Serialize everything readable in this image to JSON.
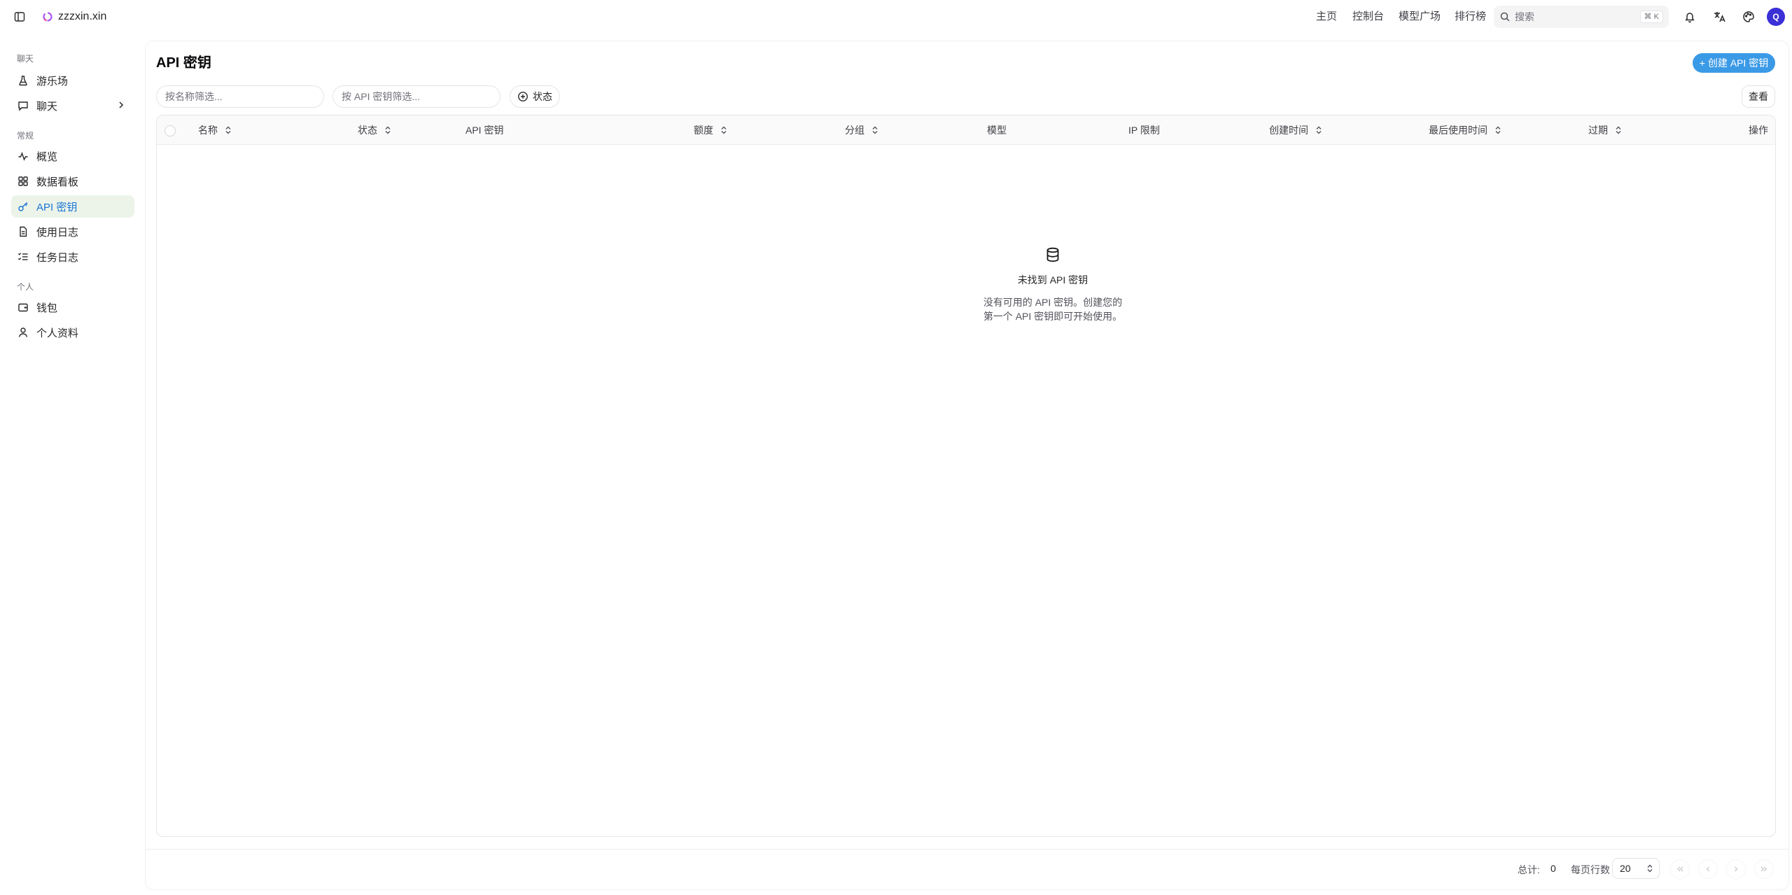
{
  "site": {
    "name": "zzzxin.xin"
  },
  "topnav": {
    "home": "主页",
    "console": "控制台",
    "models": "模型广场",
    "ranking": "排行榜"
  },
  "search": {
    "placeholder": "搜索",
    "shortcut": "⌘ K"
  },
  "user": {
    "avatar_letter": "Q"
  },
  "sidebar": {
    "groups": [
      {
        "label": "聊天",
        "items": [
          {
            "label": "游乐场",
            "icon": "flask-icon"
          },
          {
            "label": "聊天",
            "icon": "message-icon"
          }
        ]
      },
      {
        "label": "常规",
        "items": [
          {
            "label": "概览",
            "icon": "activity-icon"
          },
          {
            "label": "数据看板",
            "icon": "dashboard-icon"
          },
          {
            "label": "API 密钥",
            "icon": "key-icon",
            "active": true
          },
          {
            "label": "使用日志",
            "icon": "file-text-icon"
          },
          {
            "label": "任务日志",
            "icon": "list-checks-icon"
          }
        ]
      },
      {
        "label": "个人",
        "items": [
          {
            "label": "钱包",
            "icon": "wallet-icon"
          },
          {
            "label": "个人资料",
            "icon": "user-icon"
          }
        ]
      }
    ]
  },
  "page": {
    "title": "API 密钥",
    "create_label": "+ 创建 API 密钥",
    "filter_name_placeholder": "按名称筛选...",
    "filter_key_placeholder": "按 API 密钥筛选...",
    "status_filter_label": "状态",
    "view_label": "查看"
  },
  "table": {
    "columns": [
      {
        "key": "name",
        "label": "名称",
        "sortable": true
      },
      {
        "key": "status",
        "label": "状态",
        "sortable": true
      },
      {
        "key": "api_key",
        "label": "API 密钥",
        "sortable": false
      },
      {
        "key": "quota",
        "label": "额度",
        "sortable": true
      },
      {
        "key": "group",
        "label": "分组",
        "sortable": true
      },
      {
        "key": "model",
        "label": "模型",
        "sortable": false
      },
      {
        "key": "ip_limit",
        "label": "IP 限制",
        "sortable": false
      },
      {
        "key": "created_at",
        "label": "创建时间",
        "sortable": true
      },
      {
        "key": "last_used",
        "label": "最后使用时间",
        "sortable": true
      },
      {
        "key": "expires",
        "label": "过期",
        "sortable": true
      },
      {
        "key": "actions",
        "label": "操作",
        "sortable": false
      }
    ],
    "rows": []
  },
  "empty_state": {
    "title": "未找到 API 密钥",
    "desc": "没有可用的 API 密钥。创建您的第一个 API 密钥即可开始使用。"
  },
  "pagination": {
    "total_label": "总计:",
    "total_value": "0",
    "rows_per_page_label": "每页行数",
    "rows_per_page": "20"
  },
  "colors": {
    "accent": "#3b9ae6",
    "active_bg": "#ecf4e9",
    "active_text": "#1b74d6",
    "avatar": "#3b2fd6"
  }
}
